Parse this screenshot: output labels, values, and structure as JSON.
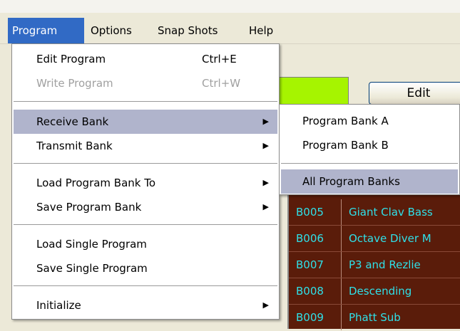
{
  "menubar": {
    "items": [
      "Program",
      "Options",
      "Snap Shots",
      "Help"
    ]
  },
  "background": {
    "edit_button": "Edit",
    "swatch_color": "#a6f400",
    "rows": [
      {
        "num": "B005",
        "name": "Giant Clav Bass"
      },
      {
        "num": "B006",
        "name": "Octave Diver M"
      },
      {
        "num": "B007",
        "name": "P3 and Rezlie"
      },
      {
        "num": "B008",
        "name": "Descending"
      },
      {
        "num": "B009",
        "name": "Phatt Sub"
      }
    ]
  },
  "program_menu": {
    "edit_program": {
      "label": "Edit Program",
      "shortcut": "Ctrl+E"
    },
    "write_program": {
      "label": "Write Program",
      "shortcut": "Ctrl+W"
    },
    "receive_bank": "Receive Bank",
    "transmit_bank": "Transmit Bank",
    "load_bank_to": "Load Program Bank To",
    "save_bank": "Save Program Bank",
    "load_single": "Load Single Program",
    "save_single": "Save Single Program",
    "initialize": "Initialize"
  },
  "submenu": {
    "bank_a": "Program Bank A",
    "bank_b": "Program Bank B",
    "all_banks": "All Program Banks"
  },
  "icons": {
    "submenu_arrow": "▶"
  },
  "colors": {
    "highlight": "#b0b4cc",
    "menu_active": "#316ac5",
    "grid_bg": "#5a1c0a",
    "grid_text": "#2fe0e8"
  }
}
